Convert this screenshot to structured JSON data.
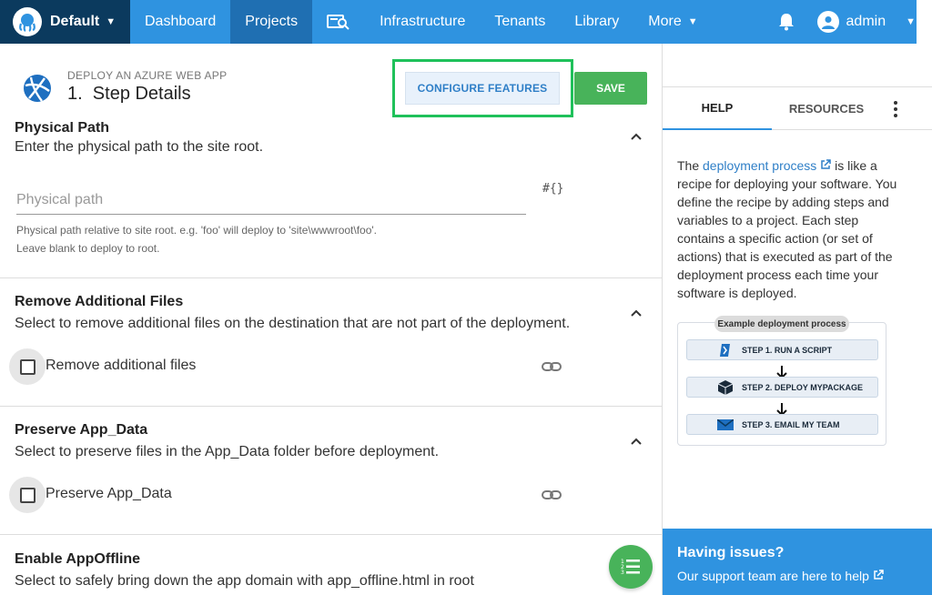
{
  "nav": {
    "space": "Default",
    "items": [
      "Dashboard",
      "Projects",
      "Infrastructure",
      "Tenants",
      "Library",
      "More"
    ],
    "active": "Projects",
    "user": "admin"
  },
  "header": {
    "overline": "DEPLOY AN AZURE WEB APP",
    "title": "1.  Step Details",
    "configure_label": "CONFIGURE FEATURES",
    "save_label": "SAVE"
  },
  "sections": {
    "physical_path": {
      "title": "Physical Path",
      "desc": "Enter the physical path to the site root.",
      "placeholder": "Physical path",
      "hint1": "Physical path relative to site root. e.g. 'foo' will deploy to 'site\\wwwroot\\foo'.",
      "hint2": "Leave blank to deploy to root.",
      "var_button": "#{}"
    },
    "remove_files": {
      "title": "Remove Additional Files",
      "desc": "Select to remove additional files on the destination that are not part of the deployment.",
      "checkbox_label": "Remove additional files",
      "checked": false
    },
    "preserve_app_data": {
      "title": "Preserve App_Data",
      "desc": "Select to preserve files in the App_Data folder before deployment.",
      "checkbox_label": "Preserve App_Data",
      "checked": false
    },
    "app_offline": {
      "title": "Enable AppOffline",
      "desc": "Select to safely bring down the app domain with app_offline.html in root"
    }
  },
  "sidebar": {
    "tabs": [
      "HELP",
      "RESOURCES"
    ],
    "active_tab": "HELP",
    "help_prefix": "The ",
    "help_link": "deployment process",
    "help_body": " is like a recipe for deploying your software. You define the recipe by adding steps and variables to a project. Each step contains a specific action (or set of actions) that is executed as part of the deployment process each time your software is deployed.",
    "diagram": {
      "title": "Example deployment process",
      "steps": [
        "STEP 1. RUN A SCRIPT",
        "STEP 2. DEPLOY MYPACKAGE",
        "STEP 3. EMAIL MY TEAM"
      ]
    },
    "issues_title": "Having issues?",
    "issues_link": "Our support team are here to help"
  },
  "colors": {
    "nav": "#2f93e0",
    "nav_active": "#1f6fb2",
    "space": "#0b3a5e",
    "save": "#48b35a",
    "highlight": "#1fc15a"
  }
}
